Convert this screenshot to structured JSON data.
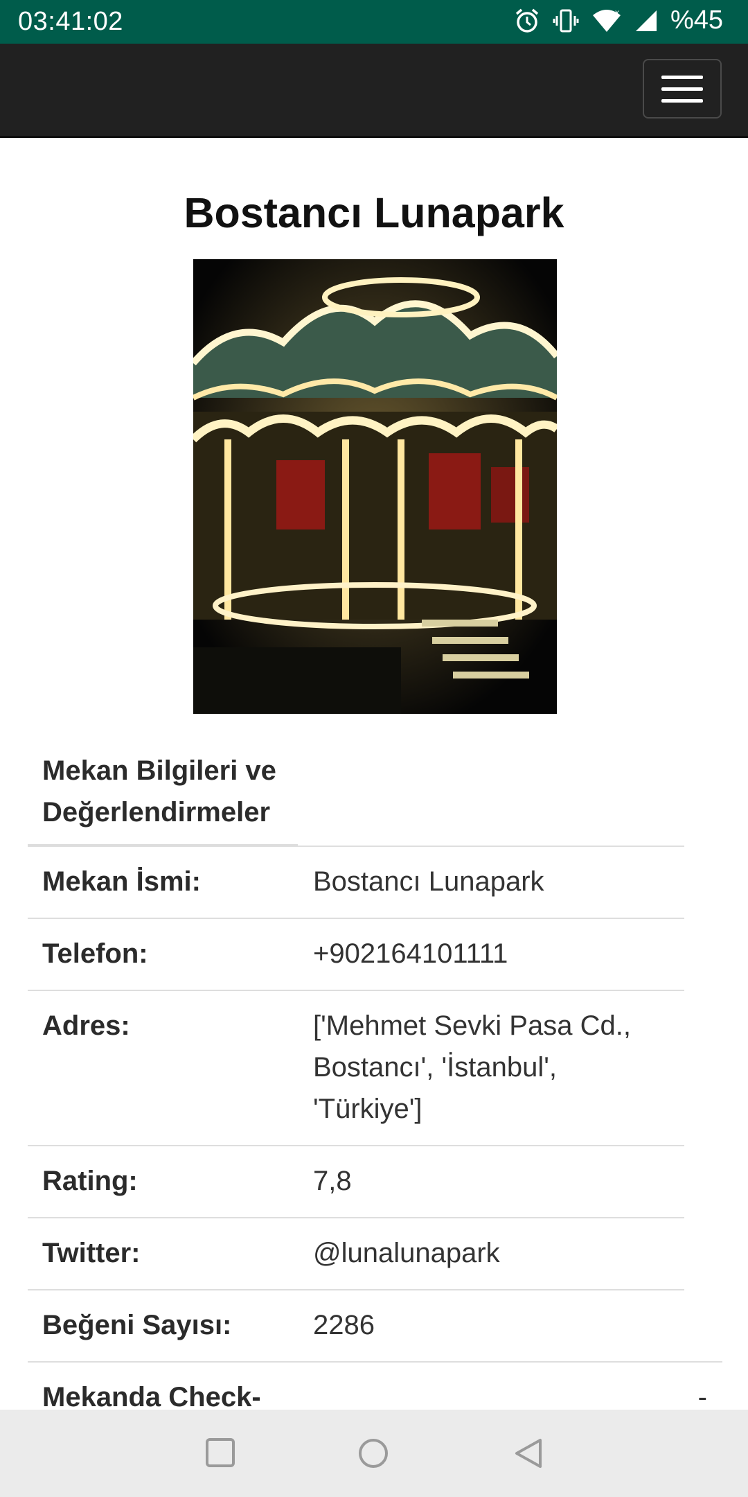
{
  "status": {
    "time": "03:41:02",
    "battery": "%45"
  },
  "page": {
    "title": "Bostancı Lunapark"
  },
  "photo": {
    "alt": "carousel-photo"
  },
  "table": {
    "section_title": "Mekan Bilgileri ve Değerlendirmeler",
    "rows": [
      {
        "label": "Mekan İsmi:",
        "value": "Bostancı Lunapark"
      },
      {
        "label": "Telefon:",
        "value": "+902164101111"
      },
      {
        "label": "Adres:",
        "value": "['Mehmet Sevki Pasa Cd., Bostancı', 'İstanbul', 'Türkiye']"
      },
      {
        "label": "Rating:",
        "value": "7,8"
      },
      {
        "label": "Twitter:",
        "value": "@lunalunapark"
      },
      {
        "label": "Beğeni Sayısı:",
        "value": "2286"
      },
      {
        "label": "Mekanda Check-",
        "value": "-"
      }
    ]
  },
  "colors": {
    "status_bar": "#005c4b",
    "navbar": "#212121"
  }
}
